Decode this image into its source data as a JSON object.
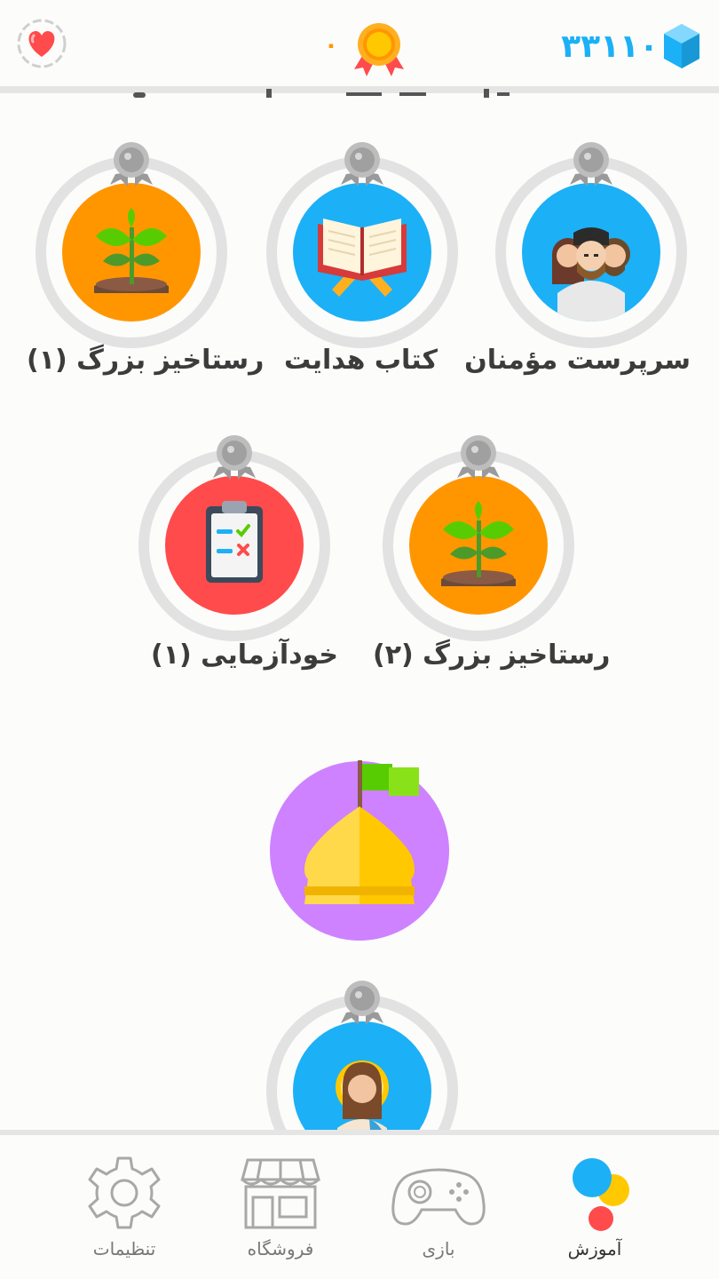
{
  "header": {
    "hearts_icon": "heart-icon",
    "medal_count": "۰",
    "gems_count": "۳۳۱۱۰"
  },
  "skills": [
    {
      "label": "سرپرست مؤمنان",
      "color": "#1cb0f6",
      "icon": "people-icon"
    },
    {
      "label": "کتاب هدایت",
      "color": "#1cb0f6",
      "icon": "book-icon"
    },
    {
      "label": "رستاخیز بزرگ (۱)",
      "color": "#ff9600",
      "icon": "sprout-icon"
    },
    {
      "label": "رستاخیز بزرگ (۲)",
      "color": "#ff9600",
      "icon": "sprout-icon"
    },
    {
      "label": "خودآزمایی (۱)",
      "color": "#ff4b4b",
      "icon": "checklist-icon"
    },
    {
      "label": "",
      "color": "#1cb0f6",
      "icon": "prophet-icon"
    }
  ],
  "checkpoint": {
    "color": "#ce82ff",
    "icon": "castle-icon"
  },
  "nav": {
    "learn": "آموزش",
    "game": "بازی",
    "shop": "فروشگاه",
    "settings": "تنظیمات"
  }
}
